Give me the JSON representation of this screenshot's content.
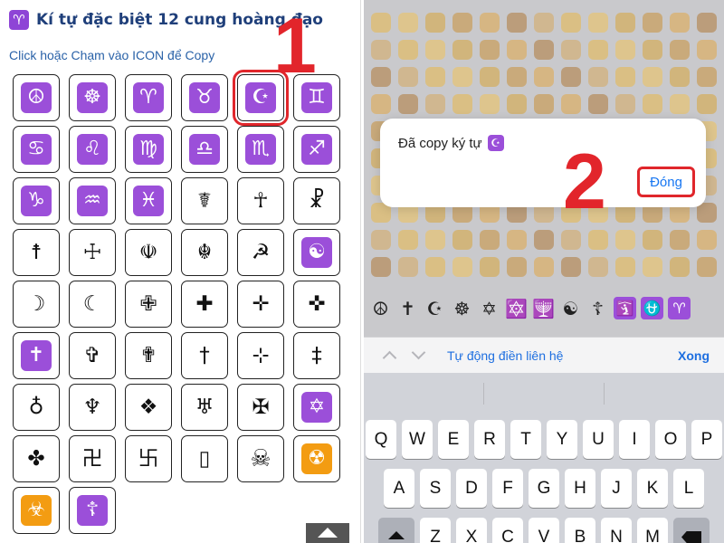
{
  "left": {
    "title": "Kí tự đặc biệt 12 cung hoàng đạo",
    "title_icon": "♈",
    "subtitle": "Click hoặc Chạm vào ICON để Copy",
    "step_number": "1",
    "selected_index": 4,
    "accent_color": "#e0262b",
    "icons": [
      {
        "glyph": "☮",
        "style": "purple",
        "name": "peace-icon"
      },
      {
        "glyph": "☸",
        "style": "purple",
        "name": "dharma-wheel-icon"
      },
      {
        "glyph": "♈",
        "style": "purple",
        "name": "aries-icon"
      },
      {
        "glyph": "♉",
        "style": "purple",
        "name": "taurus-icon"
      },
      {
        "glyph": "☪",
        "style": "purple",
        "name": "star-crescent-icon"
      },
      {
        "glyph": "♊",
        "style": "purple",
        "name": "gemini-icon"
      },
      {
        "glyph": "♋",
        "style": "purple",
        "name": "cancer-icon"
      },
      {
        "glyph": "♌",
        "style": "purple",
        "name": "leo-icon"
      },
      {
        "glyph": "♍",
        "style": "purple",
        "name": "virgo-icon"
      },
      {
        "glyph": "♎",
        "style": "purple",
        "name": "libra-icon"
      },
      {
        "glyph": "♏",
        "style": "purple",
        "name": "scorpio-icon"
      },
      {
        "glyph": "♐",
        "style": "purple",
        "name": "sagittarius-icon"
      },
      {
        "glyph": "♑",
        "style": "purple",
        "name": "capricorn-icon"
      },
      {
        "glyph": "♒",
        "style": "purple",
        "name": "aquarius-icon"
      },
      {
        "glyph": "♓",
        "style": "purple",
        "name": "pisces-icon"
      },
      {
        "glyph": "☤",
        "style": "plain",
        "name": "caduceus-icon"
      },
      {
        "glyph": "☥",
        "style": "plain",
        "name": "ankh-icon"
      },
      {
        "glyph": "☧",
        "style": "plain",
        "name": "chi-rho-icon"
      },
      {
        "glyph": "☨",
        "style": "plain",
        "name": "cross-of-lorraine-icon"
      },
      {
        "glyph": "☩",
        "style": "plain",
        "name": "cross-of-jerusalem-icon"
      },
      {
        "glyph": "☫",
        "style": "plain",
        "name": "farsi-symbol-icon"
      },
      {
        "glyph": "☬",
        "style": "plain",
        "name": "khanda-icon"
      },
      {
        "glyph": "☭",
        "style": "plain",
        "name": "hammer-sickle-icon"
      },
      {
        "glyph": "☯",
        "style": "purple",
        "name": "yin-yang-icon"
      },
      {
        "glyph": "☽",
        "style": "plain",
        "name": "first-quarter-moon-icon"
      },
      {
        "glyph": "☾",
        "style": "plain",
        "name": "last-quarter-moon-icon"
      },
      {
        "glyph": "✙",
        "style": "plain",
        "name": "outlined-greek-cross-icon"
      },
      {
        "glyph": "✚",
        "style": "plain",
        "name": "heavy-greek-cross-icon"
      },
      {
        "glyph": "✛",
        "style": "plain",
        "name": "open-centre-cross-icon"
      },
      {
        "glyph": "✜",
        "style": "plain",
        "name": "heavy-open-centre-cross-icon"
      },
      {
        "glyph": "✝",
        "style": "purple",
        "name": "latin-cross-icon"
      },
      {
        "glyph": "✞",
        "style": "plain",
        "name": "shadowed-latin-cross-icon"
      },
      {
        "glyph": "✟",
        "style": "plain",
        "name": "outlined-latin-cross-icon"
      },
      {
        "glyph": "†",
        "style": "plain",
        "name": "dagger-icon"
      },
      {
        "glyph": "⊹",
        "style": "plain",
        "name": "hermitian-cross-icon"
      },
      {
        "glyph": "‡",
        "style": "plain",
        "name": "double-dagger-icon"
      },
      {
        "glyph": "♁",
        "style": "plain",
        "name": "earth-icon"
      },
      {
        "glyph": "♆",
        "style": "plain",
        "name": "neptune-icon"
      },
      {
        "glyph": "❖",
        "style": "plain",
        "name": "diamond-cross-icon"
      },
      {
        "glyph": "♅",
        "style": "plain",
        "name": "uranus-icon"
      },
      {
        "glyph": "✠",
        "style": "plain",
        "name": "maltese-cross-icon"
      },
      {
        "glyph": "✡",
        "style": "purple",
        "name": "star-of-david-icon"
      },
      {
        "glyph": "✤",
        "style": "plain",
        "name": "four-balloon-cross-icon"
      },
      {
        "glyph": "卍",
        "style": "plain",
        "name": "manji-left-icon"
      },
      {
        "glyph": "卐",
        "style": "plain",
        "name": "manji-right-icon"
      },
      {
        "glyph": "▯",
        "style": "plain",
        "name": "empty-box-icon"
      },
      {
        "glyph": "☠",
        "style": "white",
        "name": "skull-crossbones-icon"
      },
      {
        "glyph": "☢",
        "style": "orange",
        "name": "radioactive-icon"
      },
      {
        "glyph": "☣",
        "style": "orange",
        "name": "biohazard-icon"
      },
      {
        "glyph": "☦",
        "style": "purple",
        "name": "orthodox-cross-icon"
      }
    ]
  },
  "right": {
    "dialog_message": "Đã copy ký tự",
    "dialog_icon": "☪",
    "dialog_button": "Đóng",
    "step_number": "2",
    "accessory_label": "Tự động điền liên hệ",
    "accessory_done": "Xong",
    "keyboard_row1": [
      "Q",
      "W",
      "E",
      "R",
      "T",
      "Y",
      "U",
      "I",
      "O",
      "P"
    ],
    "keyboard_row2": [
      "A",
      "S",
      "D",
      "F",
      "G",
      "H",
      "J",
      "K",
      "L"
    ],
    "keyboard_row3": [
      "Z",
      "X",
      "C",
      "V",
      "B",
      "N",
      "M"
    ],
    "symbol_row": [
      "☮",
      "✝",
      "☪",
      "☸",
      "✡",
      "🔯",
      "🕎",
      "☯",
      "☦",
      "🛐",
      "⛎",
      "♈"
    ],
    "link_color": "#1e6fe0"
  }
}
